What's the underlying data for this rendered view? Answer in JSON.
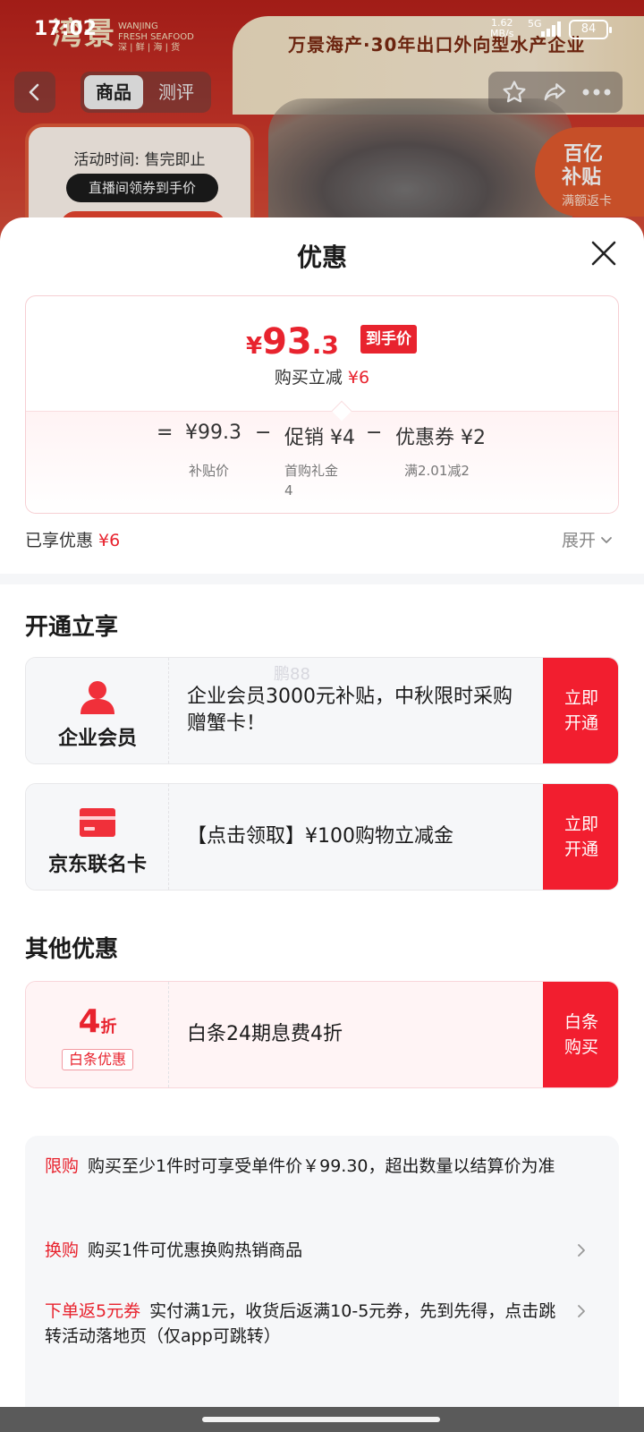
{
  "status_bar": {
    "time": "17:02",
    "speed": "1.62",
    "speed_unit": "MB/s",
    "network": "5G",
    "battery": "84"
  },
  "background": {
    "logo": "湾景",
    "logo_sub_en": "WANJING",
    "logo_sub_en2": "FRESH SEAFOOD",
    "logo_sub_cn": "深 | 鲜 | 海 | 货",
    "banner_text": "万景海产·30年出口外向型水产企业",
    "activity_time": "活动时间: 售完即止",
    "coupon_pill": "直播间领券到手价",
    "badge_line1": "百亿",
    "badge_line2": "补贴",
    "badge_line3": "满额返卡"
  },
  "nav": {
    "tabs": [
      {
        "label": "商品",
        "active": true
      },
      {
        "label": "测评",
        "active": false
      }
    ]
  },
  "sheet": {
    "title": "优惠",
    "final_price": {
      "yen": "¥",
      "integer": "93",
      "decimal": ".3",
      "tag": "到手价"
    },
    "saving": {
      "label": "购买立减",
      "amount": "¥6"
    },
    "formula": {
      "equals": "=",
      "base": {
        "value": "¥99.3",
        "caption": "补贴价"
      },
      "minus1": "−",
      "promo": {
        "value": "促销 ¥4",
        "caption_line1": "首购礼金",
        "caption_line2": "4"
      },
      "minus2": "−",
      "coupon": {
        "value": "优惠券 ¥2",
        "caption": "满2.01减2"
      }
    },
    "enjoyed": {
      "label": "已享优惠",
      "amount": "¥6"
    },
    "expand_label": "展开"
  },
  "open_section": {
    "title": "开通立享",
    "items": [
      {
        "name": "企业会员",
        "text": "企业会员3000元补贴，中秋限时采购赠蟹卡！",
        "button_line1": "立即",
        "button_line2": "开通"
      },
      {
        "name": "京东联名卡",
        "text": "【点击领取】¥100购物立减金",
        "button_line1": "立即",
        "button_line2": "开通"
      }
    ]
  },
  "other_section": {
    "title": "其他优惠",
    "item": {
      "discount_num": "4",
      "discount_unit": "折",
      "label": "白条优惠",
      "text": "白条24期息费4折",
      "button_line1": "白条",
      "button_line2": "购买"
    }
  },
  "rules": [
    {
      "tag": "限购",
      "text": "购买至少1件时可享受单件价￥99.30，超出数量以结算价为准"
    },
    {
      "tag": "换购",
      "text": "购买1件可优惠换购热销商品"
    },
    {
      "tag": "下单返5元券",
      "text": "实付满1元，收货后返满10-5元券，先到先得，点击跳转活动落地页（仅app可跳转）"
    }
  ],
  "watermark": "鹏88",
  "colors": {
    "accent": "#e8232e",
    "button_red": "#f21e2f"
  },
  "icons": [
    "back-icon",
    "star-icon",
    "share-icon",
    "more-icon",
    "close-icon",
    "person-icon",
    "card-icon",
    "chevron-down-icon",
    "chevron-right-icon"
  ]
}
